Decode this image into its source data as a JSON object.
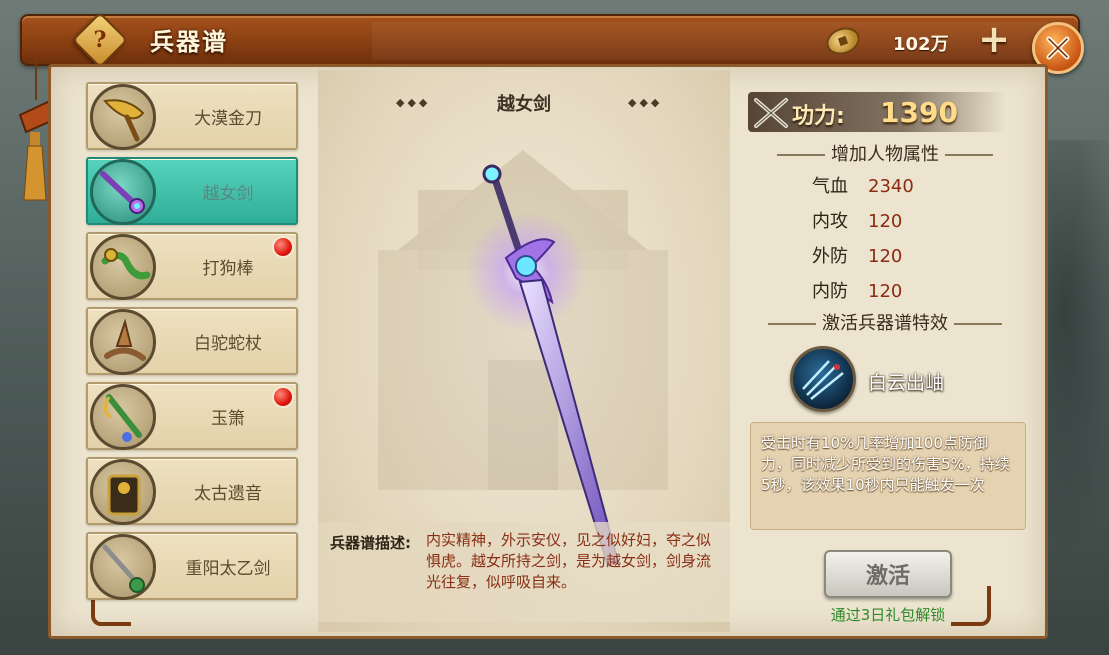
{
  "header": {
    "title": "兵器谱",
    "help_icon": "question-mark",
    "currency_icon": "coin-icon",
    "currency_value": "102万",
    "plus_label": "+",
    "close_icon": "close-icon"
  },
  "weapon_list": [
    {
      "label": "大漠金刀",
      "selected": false,
      "badge": false
    },
    {
      "label": "越女剑",
      "selected": true,
      "badge": false
    },
    {
      "label": "打狗棒",
      "selected": false,
      "badge": true
    },
    {
      "label": "白驼蛇杖",
      "selected": false,
      "badge": false
    },
    {
      "label": "玉箫",
      "selected": false,
      "badge": true
    },
    {
      "label": "太古遗音",
      "selected": false,
      "badge": false
    },
    {
      "label": "重阳太乙剑",
      "selected": false,
      "badge": false
    }
  ],
  "showcase": {
    "weapon_name": "越女剑",
    "decoration": "◆◆◆",
    "description_label": "兵器谱描述:",
    "description_text": "内实精神，外示安仪，见之似好妇，夺之似惧虎。越女所持之剑，是为越女剑，剑身流光往复，似呼吸自来。"
  },
  "stats": {
    "power_label": "功力:",
    "power_value": "1390",
    "attributes_heading": "增加人物属性",
    "attributes": [
      {
        "name": "气血",
        "value": "2340"
      },
      {
        "name": "内攻",
        "value": "120"
      },
      {
        "name": "外防",
        "value": "120"
      },
      {
        "name": "内防",
        "value": "120"
      }
    ],
    "effect_heading": "激活兵器谱特效",
    "skill_name": "白云出岫",
    "effect_text": "受击时有10%几率增加100点防御力，同时减少所受到的伤害5%，持续5秒，该效果10秒内只能触发一次",
    "activate_label": "激活",
    "unlock_hint": "通过3日礼包解锁"
  },
  "colors": {
    "header_brown": "#8a3f12",
    "selected_teal": "#2fae98",
    "value_red": "#8d2a12",
    "hint_green": "#2c8a2a"
  }
}
